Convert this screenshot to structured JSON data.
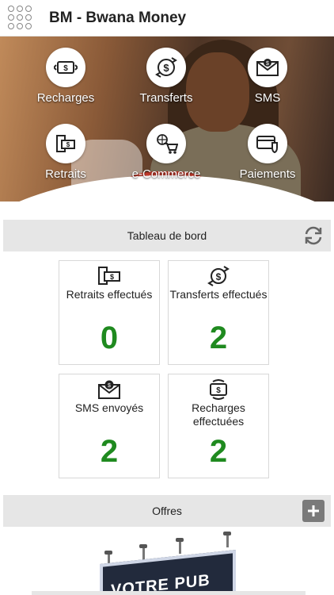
{
  "app": {
    "title": "BM - Bwana Money"
  },
  "services": [
    {
      "label": "Recharges",
      "icon": "recharge-cash-icon"
    },
    {
      "label": "Transferts",
      "icon": "dollar-transfer-icon"
    },
    {
      "label": "SMS",
      "icon": "sms-envelope-icon"
    },
    {
      "label": "Retraits",
      "icon": "atm-withdraw-icon"
    },
    {
      "label": "e-Commerce",
      "icon": "globe-cart-icon"
    },
    {
      "label": "Paiements",
      "icon": "card-shield-icon"
    }
  ],
  "dashboard": {
    "title": "Tableau de bord",
    "refresh_icon": "refresh-icon",
    "cards": [
      {
        "label": "Retraits effectués",
        "value": "0",
        "icon": "atm-withdraw-icon"
      },
      {
        "label": "Transferts effectués",
        "value": "2",
        "icon": "dollar-transfer-icon"
      },
      {
        "label": "SMS envoyés",
        "value": "2",
        "icon": "sms-envelope-icon"
      },
      {
        "label": "Recharges effectuées",
        "value": "2",
        "icon": "recharge-cash-icon"
      }
    ],
    "value_color": "#1f8a1f"
  },
  "offers": {
    "title": "Offres",
    "add_icon": "plus-icon"
  },
  "ad": {
    "text": "VOTRE PUB ICI"
  }
}
